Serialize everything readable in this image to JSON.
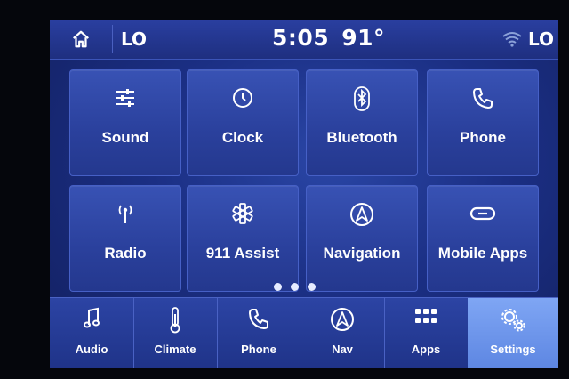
{
  "status": {
    "home_icon": "home-icon",
    "left_label": "LO",
    "time": "5:05",
    "temperature": "91°",
    "wifi_icon": "wifi-icon",
    "right_label": "LO"
  },
  "tiles": [
    {
      "label": "Sound",
      "icon": "sliders-icon"
    },
    {
      "label": "Clock",
      "icon": "clock-icon"
    },
    {
      "label": "Bluetooth",
      "icon": "bluetooth-icon"
    },
    {
      "label": "Phone",
      "icon": "phone-icon"
    },
    {
      "label": "Radio",
      "icon": "antenna-icon"
    },
    {
      "label": "911 Assist",
      "icon": "star-of-life-icon"
    },
    {
      "label": "Navigation",
      "icon": "navigation-arrow-icon"
    },
    {
      "label": "Mobile Apps",
      "icon": "link-icon"
    }
  ],
  "pager": {
    "pages": 3
  },
  "bottom_nav": [
    {
      "label": "Audio",
      "icon": "music-note-icon"
    },
    {
      "label": "Climate",
      "icon": "thermometer-icon"
    },
    {
      "label": "Phone",
      "icon": "phone-icon"
    },
    {
      "label": "Nav",
      "icon": "navigation-arrow-icon"
    },
    {
      "label": "Apps",
      "icon": "grid-icon"
    },
    {
      "label": "Settings",
      "icon": "gears-icon"
    }
  ],
  "active_nav": "Settings",
  "colors": {
    "accent": "#6b93ea",
    "background": "#1b2f84"
  }
}
